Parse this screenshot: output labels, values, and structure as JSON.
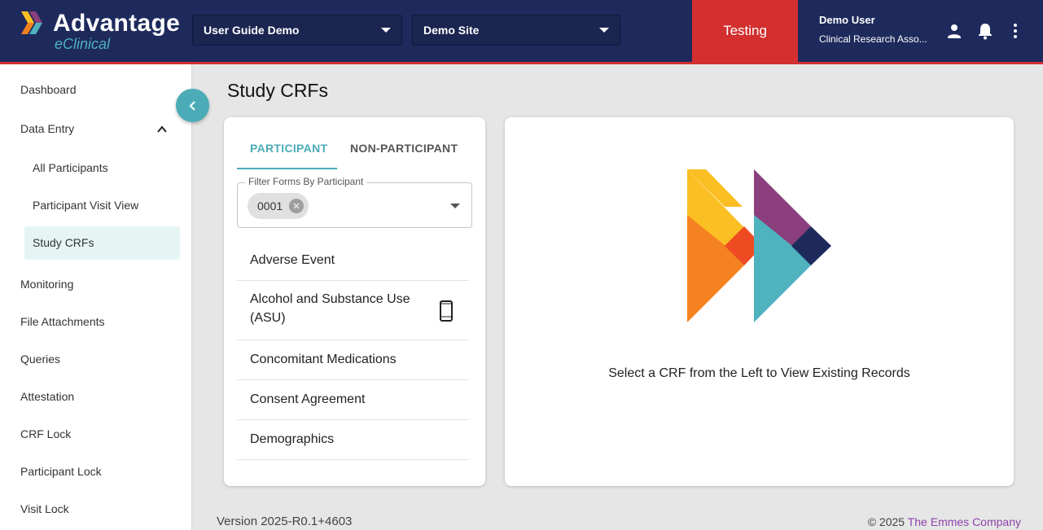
{
  "header": {
    "logo_title": "Advantage",
    "logo_subtitle": "eClinical",
    "study_select": "User Guide Demo",
    "site_select": "Demo Site",
    "environment": "Testing",
    "user_name": "Demo User",
    "user_role": "Clinical Research Asso..."
  },
  "sidebar": {
    "items": [
      {
        "label": "Dashboard"
      },
      {
        "label": "Data Entry"
      },
      {
        "label": "All Participants"
      },
      {
        "label": "Participant Visit View"
      },
      {
        "label": "Study CRFs"
      },
      {
        "label": "Monitoring"
      },
      {
        "label": "File Attachments"
      },
      {
        "label": "Queries"
      },
      {
        "label": "Attestation"
      },
      {
        "label": "CRF Lock"
      },
      {
        "label": "Participant Lock"
      },
      {
        "label": "Visit Lock"
      }
    ],
    "active": "Study CRFs"
  },
  "main": {
    "title": "Study CRFs",
    "tabs": [
      {
        "label": "PARTICIPANT",
        "selected": true
      },
      {
        "label": "NON-PARTICIPANT",
        "selected": false
      }
    ],
    "filter": {
      "label": "Filter Forms By Participant",
      "chip": "0001"
    },
    "crfs": [
      {
        "line1": "Adverse Event",
        "line2": ""
      },
      {
        "line1": "Alcohol and Substance Use",
        "line2": "(ASU)",
        "icon": "mobile-phone-icon"
      },
      {
        "line1": "Concomitant Medications",
        "line2": ""
      },
      {
        "line1": "Consent Agreement",
        "line2": ""
      },
      {
        "line1": "Demographics",
        "line2": ""
      }
    ],
    "empty_message": "Select a CRF from the Left to View Existing Records"
  },
  "footer": {
    "version": "Version 2025-R0.1+4603",
    "copyright": "© 2025",
    "company": "The Emmes Company"
  },
  "colors": {
    "header_bg": "#1e2a5c",
    "accent_teal": "#4bacb7",
    "env_red": "#d32f2f",
    "logo_yellow": "#fbbf24",
    "logo_orange": "#f58220",
    "logo_red": "#ef4b23",
    "logo_purple": "#8b3f7c",
    "logo_navy": "#1e2a5c",
    "logo_teal": "#4fb3bf"
  }
}
